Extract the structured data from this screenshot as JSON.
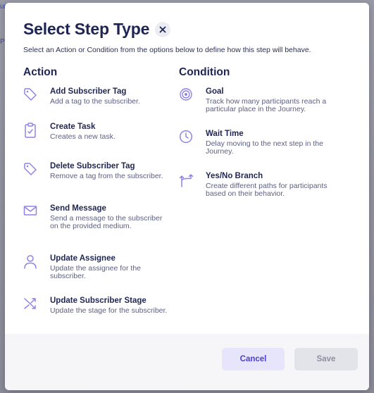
{
  "background": {
    "fragments": [
      "ur",
      "Pe"
    ]
  },
  "modal": {
    "title": "Select Step Type",
    "subtitle": "Select an Action or Condition from the options below to define how this step will behave.",
    "close_icon": "close-icon"
  },
  "action": {
    "heading": "Action",
    "items": [
      {
        "name": "Add Subscriber Tag",
        "desc": "Add a tag to the subscriber.",
        "icon": "tag-icon"
      },
      {
        "name": "Create Task",
        "desc": "Creates a new task.",
        "icon": "clipboard-icon"
      },
      {
        "name": "Delete Subscriber Tag",
        "desc": "Remove a tag from the subscriber.",
        "icon": "tag-icon"
      },
      {
        "name": "Send Message",
        "desc": "Send a message to the subscriber on the provided medium.",
        "icon": "mail-icon"
      },
      {
        "name": "Update Assignee",
        "desc": "Update the assignee for the subscriber.",
        "icon": "user-icon"
      },
      {
        "name": "Update Subscriber Stage",
        "desc": "Update the stage for the subscriber.",
        "icon": "shuffle-icon"
      }
    ]
  },
  "condition": {
    "heading": "Condition",
    "items": [
      {
        "name": "Goal",
        "desc": "Track how many participants reach a particular place in the Journey.",
        "icon": "target-icon"
      },
      {
        "name": "Wait Time",
        "desc": "Delay moving to the next step in the Journey.",
        "icon": "clock-icon"
      },
      {
        "name": "Yes/No Branch",
        "desc": "Create different paths for participants based on their behavior.",
        "icon": "branch-icon"
      }
    ]
  },
  "footer": {
    "cancel_label": "Cancel",
    "save_label": "Save"
  },
  "colors": {
    "accent": "#4a3fd4",
    "icon": "#8e84e6",
    "title": "#1f2553"
  }
}
